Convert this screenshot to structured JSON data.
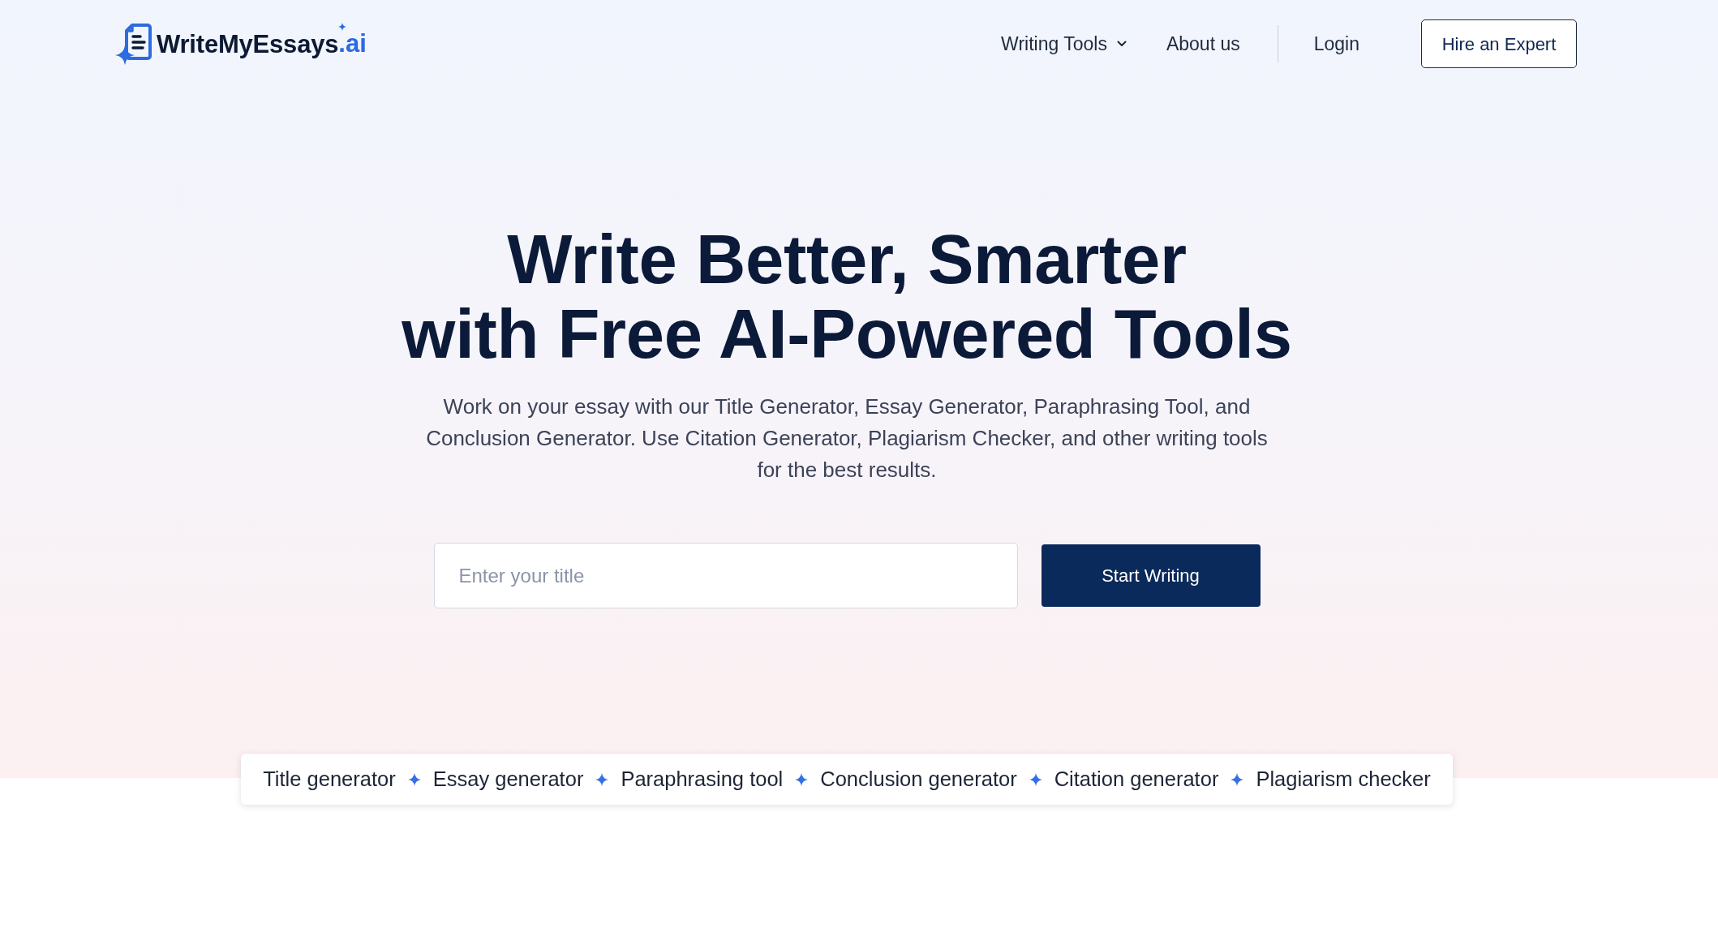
{
  "header": {
    "logo": {
      "name": "WriteMyEssays",
      "suffix": ".ai"
    },
    "nav": [
      {
        "label": "Writing Tools",
        "kind": "dropdown"
      },
      {
        "label": "About us",
        "kind": "link"
      }
    ],
    "login": "Login",
    "cta": "Hire an Expert"
  },
  "hero": {
    "title": "Write Better, Smarter\nwith Free AI-Powered Tools",
    "subtitle": "Work on your essay with our Title Generator, Essay Generator, Paraphrasing Tool, and Conclusion Generator. Use Citation Generator, Plagiarism Checker, and other writing tools for the best results.",
    "title_input": {
      "placeholder": "Enter your title"
    },
    "submit": "Start Writing"
  },
  "tools": [
    "Title generator",
    "Essay generator",
    "Paraphrasing tool",
    "Conclusion generator",
    "Citation generator",
    "Plagiarism checker"
  ]
}
